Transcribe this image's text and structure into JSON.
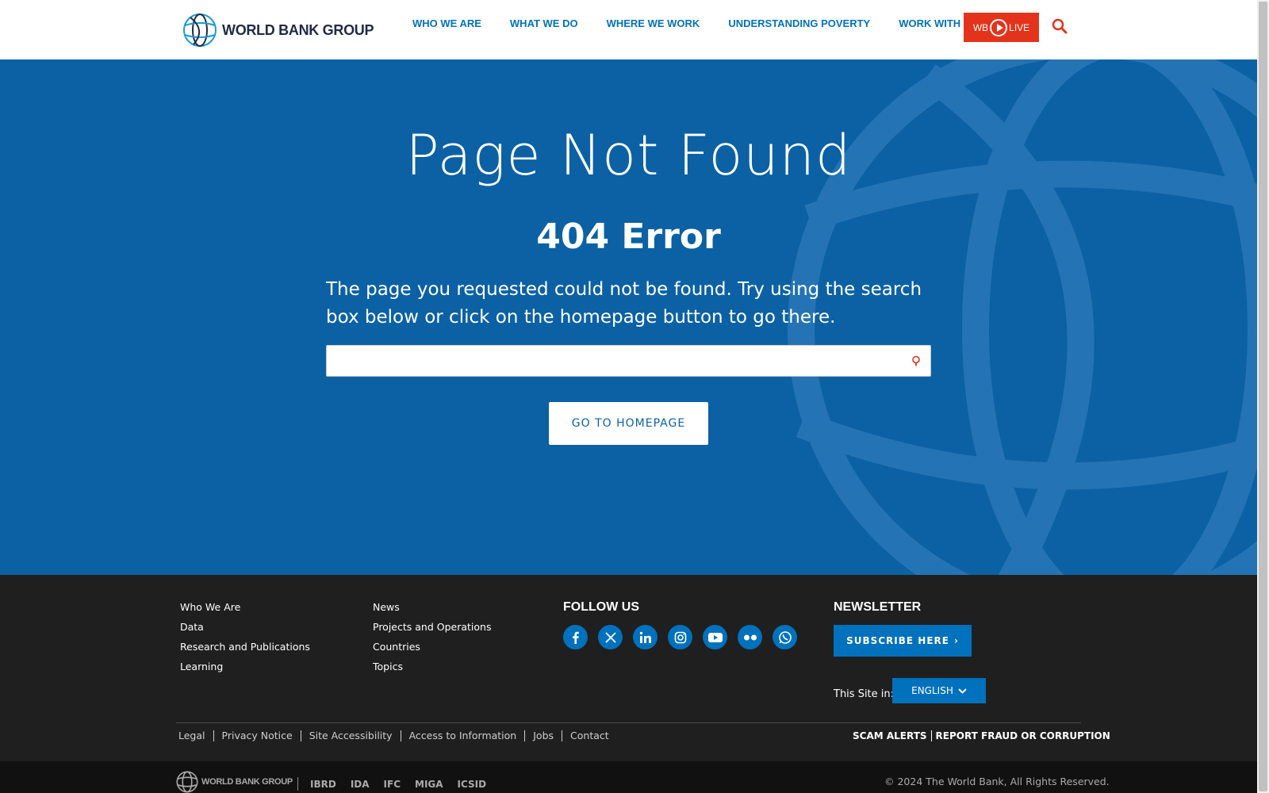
{
  "header": {
    "logo_text": "WORLD BANK GROUP",
    "nav": [
      "WHO WE ARE",
      "WHAT WE DO",
      "WHERE WE WORK",
      "UNDERSTANDING POVERTY",
      "WORK WITH US"
    ],
    "live_left": "WB",
    "live_right": "LIVE",
    "search_icon": "search-icon"
  },
  "hero": {
    "title": "Page Not Found",
    "subtitle": "404 Error",
    "message": "The page you requested could not be found. Try using the search box below or click on the homepage button to go there.",
    "search_placeholder": "",
    "homepage_button": "GO TO HOMEPAGE"
  },
  "footer": {
    "col1": [
      "Who We Are",
      "Data",
      "Research and Publications",
      "Learning"
    ],
    "col2": [
      "News",
      "Projects and Operations",
      "Countries",
      "Topics"
    ],
    "follow_heading": "FOLLOW US",
    "social": [
      "facebook-icon",
      "x-icon",
      "linkedin-icon",
      "instagram-icon",
      "youtube-icon",
      "flickr-icon",
      "whatsapp-icon"
    ],
    "newsletter_heading": "NEWSLETTER",
    "subscribe": "SUBSCRIBE HERE",
    "site_in_label": "This Site in:",
    "language": "ENGLISH",
    "legal": [
      "Legal",
      "Privacy Notice",
      "Site Accessibility",
      "Access to Information",
      "Jobs",
      "Contact"
    ],
    "alerts": [
      "SCAM ALERTS",
      "REPORT FRAUD OR CORRUPTION"
    ]
  },
  "bottom": {
    "logo_text": "WORLD BANK GROUP",
    "orgs": [
      "IBRD",
      "IDA",
      "IFC",
      "MIGA",
      "ICSID"
    ],
    "copyright": "© 2024 The World Bank, All Rights Reserved."
  },
  "colors": {
    "brand_blue": "#0b61a4",
    "link_blue": "#0071bc",
    "live_red": "#e3341b",
    "footer_dark": "#1f1f1f"
  }
}
